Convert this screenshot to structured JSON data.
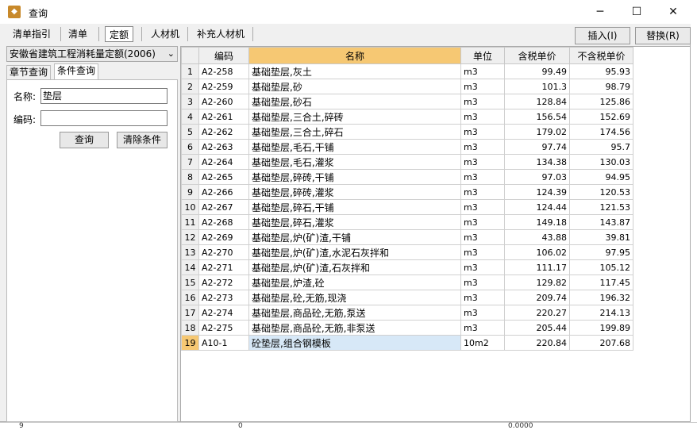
{
  "window": {
    "title": "查询",
    "minimize": "─",
    "maximize": "☐",
    "close": "✕"
  },
  "toolbar": {
    "tabs": [
      {
        "label": "清单指引"
      },
      {
        "label": "清单"
      },
      {
        "label": "定额"
      },
      {
        "label": "人材机"
      },
      {
        "label": "补充人材机"
      }
    ],
    "active_tab": "定额",
    "insert_label": "插入(I)",
    "replace_label": "替换(R)"
  },
  "left": {
    "quota_library": "安徽省建筑工程消耗量定额(2006)",
    "tabs": [
      {
        "label": "章节查询"
      },
      {
        "label": "条件查询"
      }
    ],
    "active_tab": "条件查询",
    "name_label": "名称:",
    "name_value": "垫层",
    "code_label": "编码:",
    "code_value": "",
    "query_label": "查询",
    "clear_label": "清除条件"
  },
  "grid": {
    "headers": {
      "code": "编码",
      "name": "名称",
      "unit": "单位",
      "tax_price": "含税单价",
      "notax_price": "不含税单价"
    },
    "rows": [
      {
        "n": "1",
        "code": "A2-258",
        "name": "基础垫层,灰土",
        "unit": "m3",
        "tax": "99.49",
        "notax": "95.93"
      },
      {
        "n": "2",
        "code": "A2-259",
        "name": "基础垫层,砂",
        "unit": "m3",
        "tax": "101.3",
        "notax": "98.79"
      },
      {
        "n": "3",
        "code": "A2-260",
        "name": "基础垫层,砂石",
        "unit": "m3",
        "tax": "128.84",
        "notax": "125.86"
      },
      {
        "n": "4",
        "code": "A2-261",
        "name": "基础垫层,三合土,碎砖",
        "unit": "m3",
        "tax": "156.54",
        "notax": "152.69"
      },
      {
        "n": "5",
        "code": "A2-262",
        "name": "基础垫层,三合土,碎石",
        "unit": "m3",
        "tax": "179.02",
        "notax": "174.56"
      },
      {
        "n": "6",
        "code": "A2-263",
        "name": "基础垫层,毛石,干铺",
        "unit": "m3",
        "tax": "97.74",
        "notax": "95.7"
      },
      {
        "n": "7",
        "code": "A2-264",
        "name": "基础垫层,毛石,灌浆",
        "unit": "m3",
        "tax": "134.38",
        "notax": "130.03"
      },
      {
        "n": "8",
        "code": "A2-265",
        "name": "基础垫层,碎砖,干铺",
        "unit": "m3",
        "tax": "97.03",
        "notax": "94.95"
      },
      {
        "n": "9",
        "code": "A2-266",
        "name": "基础垫层,碎砖,灌浆",
        "unit": "m3",
        "tax": "124.39",
        "notax": "120.53"
      },
      {
        "n": "10",
        "code": "A2-267",
        "name": "基础垫层,碎石,干铺",
        "unit": "m3",
        "tax": "124.44",
        "notax": "121.53"
      },
      {
        "n": "11",
        "code": "A2-268",
        "name": "基础垫层,碎石,灌浆",
        "unit": "m3",
        "tax": "149.18",
        "notax": "143.87"
      },
      {
        "n": "12",
        "code": "A2-269",
        "name": "基础垫层,炉(矿)渣,干铺",
        "unit": "m3",
        "tax": "43.88",
        "notax": "39.81"
      },
      {
        "n": "13",
        "code": "A2-270",
        "name": "基础垫层,炉(矿)渣,水泥石灰拌和",
        "unit": "m3",
        "tax": "106.02",
        "notax": "97.95"
      },
      {
        "n": "14",
        "code": "A2-271",
        "name": "基础垫层,炉(矿)渣,石灰拌和",
        "unit": "m3",
        "tax": "111.17",
        "notax": "105.12"
      },
      {
        "n": "15",
        "code": "A2-272",
        "name": "基础垫层,炉渣,砼",
        "unit": "m3",
        "tax": "129.82",
        "notax": "117.45"
      },
      {
        "n": "16",
        "code": "A2-273",
        "name": "基础垫层,砼,无筋,现浇",
        "unit": "m3",
        "tax": "209.74",
        "notax": "196.32"
      },
      {
        "n": "17",
        "code": "A2-274",
        "name": "基础垫层,商品砼,无筋,泵送",
        "unit": "m3",
        "tax": "220.27",
        "notax": "214.13"
      },
      {
        "n": "18",
        "code": "A2-275",
        "name": "基础垫层,商品砼,无筋,非泵送",
        "unit": "m3",
        "tax": "205.44",
        "notax": "199.89"
      },
      {
        "n": "19",
        "code": "A10-1",
        "name": "砼垫层,组合钢模板",
        "unit": "10m2",
        "tax": "220.84",
        "notax": "207.68"
      }
    ],
    "selected_row": "19"
  },
  "background": {
    "row_num": "9",
    "cell_a": "0",
    "cell_b": "0.0000"
  }
}
